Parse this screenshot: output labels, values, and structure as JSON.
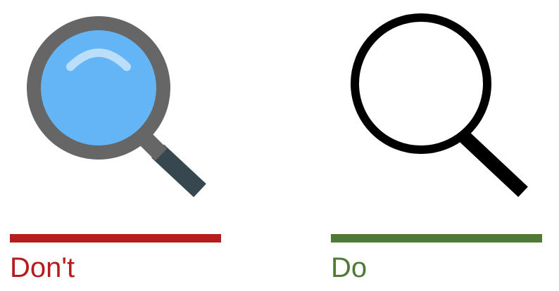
{
  "dont": {
    "label": "Don't",
    "color": "#b71c1c",
    "icon": "magnifying-glass-flat-color-icon",
    "icon_colors": {
      "rim": "#666666",
      "lens": "#64b5f6",
      "highlight": "#bbdefb",
      "handle": "#37474f"
    }
  },
  "do": {
    "label": "Do",
    "color": "#4e7a36",
    "icon": "magnifying-glass-outline-icon",
    "icon_colors": {
      "stroke": "#000000"
    }
  }
}
